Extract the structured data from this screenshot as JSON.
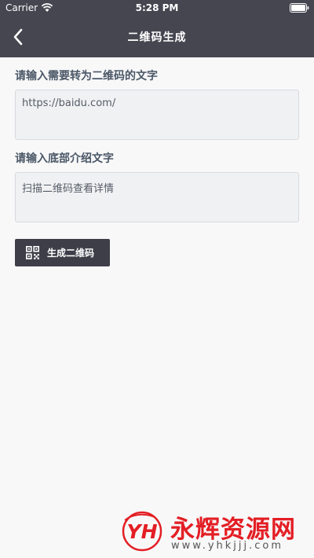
{
  "status_bar": {
    "carrier": "Carrier",
    "time": "5:28 PM",
    "icons": [
      "wifi-icon",
      "battery-icon"
    ]
  },
  "nav": {
    "title": "二维码生成",
    "back_icon": "chevron-left-icon"
  },
  "form": {
    "content_label": "请输入需要转为二维码的文字",
    "content_value": "https://baidu.com/",
    "caption_label": "请输入底部介绍文字",
    "caption_value": "扫描二维码查看详情",
    "generate_button": "生成二维码",
    "generate_icon": "qr-code-icon"
  },
  "watermark": {
    "logo_text": "YH",
    "name": "永辉资源网",
    "url": "www.yhkjjj.com"
  },
  "colors": {
    "header_bg": "#464651",
    "button_bg": "#3d3e48",
    "page_bg": "#f8f8f9",
    "label_text": "#4a5766",
    "watermark_red": "#e31e24"
  }
}
